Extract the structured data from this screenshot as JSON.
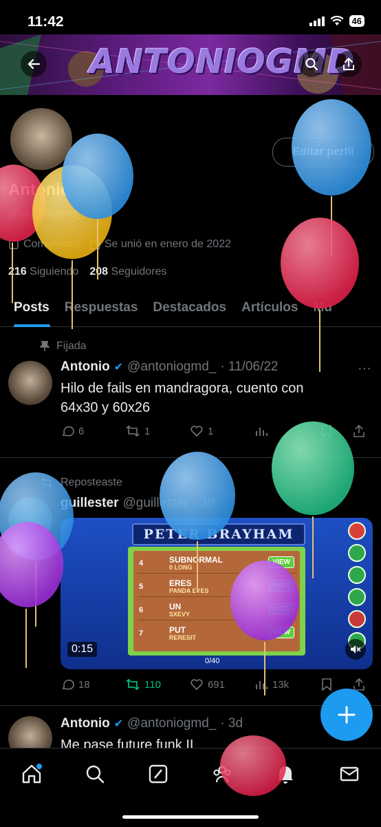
{
  "status_bar": {
    "time": "11:42",
    "battery": "46"
  },
  "banner": {
    "title": "ANTONIOGMD"
  },
  "profile": {
    "edit_label": "Editar perfil",
    "name": "Antonio",
    "handle": "@antoniogmd_",
    "community": "Comunidad",
    "joined": "Se unió en enero de 2022",
    "following_count": "216",
    "following_label": "Siguiendo",
    "followers_count": "208",
    "followers_label": "Seguidores"
  },
  "tabs": [
    {
      "label": "Posts",
      "active": true
    },
    {
      "label": "Respuestas"
    },
    {
      "label": "Destacados"
    },
    {
      "label": "Artículos"
    },
    {
      "label": "Mu"
    }
  ],
  "posts": [
    {
      "context": "Fijada",
      "author": "Antonio",
      "handle": "@antoniogmd_",
      "date": "· 11/06/22",
      "text_line1": "Hilo de fails en mandragora, cuento con",
      "text_line2": "64x30 y 60x26",
      "replies": "6",
      "reposts": "1",
      "likes": "1"
    },
    {
      "context": "Reposteaste",
      "author": "guillester",
      "handle": "@guillester",
      "date": "· 3d",
      "media_title": "PETER BRAYHAM",
      "video_time": "0:15",
      "video_progress": "0/40",
      "levels": [
        {
          "num": "4",
          "name": "SUBNORMAL",
          "sub": "0 LONG",
          "view": "VIEW"
        },
        {
          "num": "5",
          "name": "ERES",
          "sub": "PANDA EYES",
          "view": "VIEW"
        },
        {
          "num": "6",
          "name": "UN",
          "sub": "SXEVY",
          "view": "VIEW"
        },
        {
          "num": "7",
          "name": "PUT",
          "sub": "RERESIT",
          "view": "VIEW"
        }
      ],
      "replies": "18",
      "reposts": "110",
      "likes": "691",
      "views": "13k"
    },
    {
      "author": "Antonio",
      "handle": "@antoniogmd_",
      "date": "· 3d",
      "text_line1": "Me pase future funk II"
    }
  ],
  "colors": {
    "accent": "#1d9bf0",
    "repost_active": "#00ba7c",
    "muted": "#71767b"
  }
}
